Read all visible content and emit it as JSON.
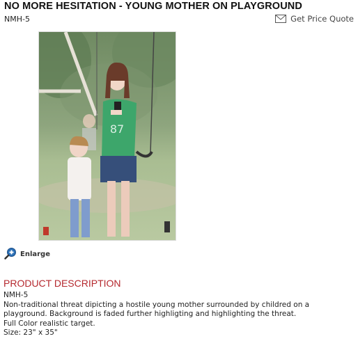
{
  "product": {
    "title": "NO MORE HESITATION - YOUNG MOTHER ON PLAYGROUND",
    "sku": "NMH-5"
  },
  "actions": {
    "quote_label": "Get Price Quote",
    "quote_icon": "envelope-icon",
    "enlarge_label": "Enlarge",
    "enlarge_icon": "magnifier-plus-icon"
  },
  "description": {
    "heading": "PRODUCT DESCRIPTION",
    "lines": [
      "NMH-5",
      "Non-traditional threat dipicting a hostile young mother surrounded by childred on a",
      "playground. Background is faded further highligting and highlighting the threat.",
      "Full Color realistic target.",
      "Size: 23\" x 35\""
    ]
  },
  "colors": {
    "heading_red": "#b5282e",
    "title_black": "#111111",
    "enlarge_icon_blue": "#2b6fb6"
  }
}
